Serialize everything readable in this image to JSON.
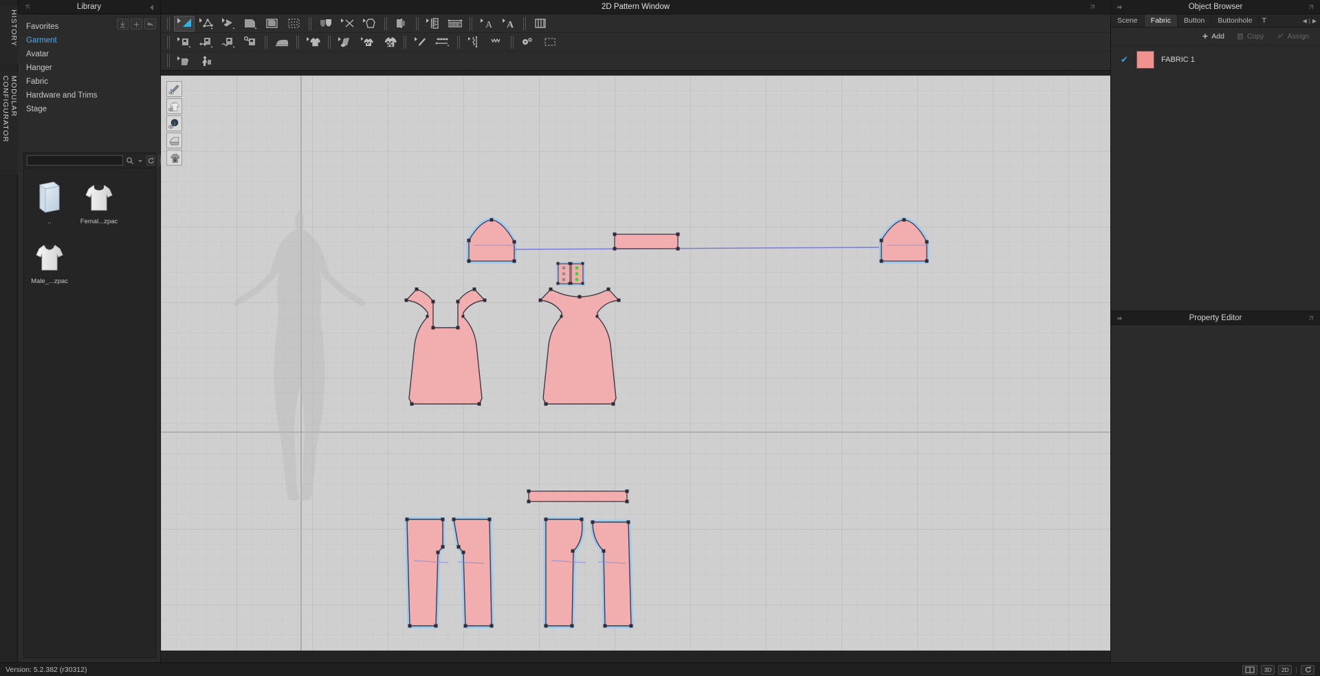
{
  "app": {
    "version_label": "Version: 5.2.382 (r30312)",
    "accent": "#5aa9e6",
    "fabric_color": "#f2aeae",
    "canvas_bg": "#cfcfcf"
  },
  "vertical_tabs": [
    {
      "label": "HISTORY",
      "name": "history"
    },
    {
      "label": "MODULAR CONFIGURATOR",
      "name": "modular-configurator"
    }
  ],
  "library": {
    "title": "Library",
    "tree": [
      {
        "label": "Favorites",
        "selected": false
      },
      {
        "label": "Garment",
        "selected": true
      },
      {
        "label": "Avatar",
        "selected": false
      },
      {
        "label": "Hanger",
        "selected": false
      },
      {
        "label": "Fabric",
        "selected": false
      },
      {
        "label": "Hardware and Trims",
        "selected": false
      },
      {
        "label": "Stage",
        "selected": false
      }
    ],
    "actions": [
      "download-icon",
      "add-icon",
      "undo-icon"
    ],
    "search": {
      "value": "",
      "placeholder": ""
    },
    "search_icons": [
      "search-icon",
      "chevron-down-icon",
      "refresh-icon",
      "list-view-icon"
    ],
    "items": [
      {
        "label": "..",
        "type": "folder"
      },
      {
        "label": "Femal...zpac",
        "type": "garment-female"
      },
      {
        "label": "Male_...zpac",
        "type": "garment-male"
      }
    ]
  },
  "main": {
    "title": "2D Pattern Window",
    "toolbar_rows": [
      [
        {
          "name": "edit-pattern-tool",
          "icon": "cursor-triangle",
          "active": true
        },
        {
          "name": "edit-curve-point-tool",
          "icon": "cursor-polyline",
          "active": false
        },
        {
          "name": "transform-pattern-tool",
          "icon": "cursor-pivot",
          "active": false
        },
        {
          "name": "polygon-tool",
          "icon": "polygon",
          "active": false
        },
        {
          "name": "rectangle-pattern-tool",
          "icon": "rect-shape",
          "active": false
        },
        {
          "name": "select-mesh-tool",
          "icon": "mesh-select",
          "active": false
        },
        {
          "sep": true
        },
        {
          "name": "internal-shape-tool",
          "icon": "shield-pair",
          "active": false
        },
        {
          "name": "cut-sew-tool",
          "icon": "scissors-cross",
          "active": false
        },
        {
          "name": "pattern-outline-tool",
          "icon": "outline-shape",
          "active": false
        },
        {
          "sep": true
        },
        {
          "name": "fold-pattern-tool",
          "icon": "fold-panel",
          "active": false
        },
        {
          "sep": true
        },
        {
          "name": "measure-tool",
          "icon": "ruler-vertical",
          "active": false
        },
        {
          "name": "tape-measure-tool",
          "icon": "tape-measure",
          "active": false
        },
        {
          "sep": true
        },
        {
          "name": "text-tool",
          "icon": "text-a",
          "active": false
        },
        {
          "name": "text-bold-tool",
          "icon": "text-a-bold",
          "active": false
        },
        {
          "sep": true
        },
        {
          "name": "grid-tool",
          "icon": "grid-columns",
          "active": false
        }
      ],
      [
        {
          "name": "sewing-tool",
          "icon": "cursor-seam",
          "active": false
        },
        {
          "name": "segment-sewing-tool",
          "icon": "seam-dots",
          "active": false
        },
        {
          "name": "free-sewing-tool",
          "icon": "seam-wave",
          "active": false
        },
        {
          "name": "edit-sewing-tool",
          "icon": "seam-search",
          "active": false
        },
        {
          "sep": true
        },
        {
          "name": "fusible-tool",
          "icon": "iron",
          "active": false
        },
        {
          "sep": true
        },
        {
          "name": "flatten-tool",
          "icon": "shirt-plain",
          "active": false
        },
        {
          "sep": true
        },
        {
          "name": "unroll-tool",
          "icon": "fabric-roll",
          "active": false
        },
        {
          "name": "texture-tool",
          "icon": "shirt-checker-small",
          "active": false
        },
        {
          "name": "print-layout-tool",
          "icon": "shirt-checker",
          "active": false
        },
        {
          "sep": true
        },
        {
          "name": "pleat-tool",
          "icon": "pen-diagonal",
          "active": false
        },
        {
          "name": "elastic-tool",
          "icon": "dots-line",
          "active": false
        },
        {
          "sep": true
        },
        {
          "name": "zigzag-tool",
          "icon": "zigzag",
          "active": false
        },
        {
          "name": "vvv-tool",
          "icon": "vvv",
          "active": false
        },
        {
          "sep": true
        },
        {
          "name": "button-tool",
          "icon": "buttons",
          "active": false
        },
        {
          "name": "marquee-tool",
          "icon": "marquee",
          "active": false
        }
      ],
      [
        {
          "name": "trace-tool",
          "icon": "trace",
          "active": false
        },
        {
          "name": "avatar-tool",
          "icon": "avatar-person",
          "active": false
        }
      ]
    ],
    "canvas_tools": [
      {
        "name": "show-pattern-outline",
        "icon": "pen-eye"
      },
      {
        "name": "show-garment",
        "icon": "shirt-eye"
      },
      {
        "name": "show-info",
        "icon": "info-eye"
      },
      {
        "name": "show-fabric",
        "icon": "fabric-fold"
      },
      {
        "name": "lock-pattern",
        "icon": "shirt-lock"
      }
    ]
  },
  "object_browser": {
    "title": "Object Browser",
    "tabs": [
      {
        "label": "Scene",
        "selected": false
      },
      {
        "label": "Fabric",
        "selected": true
      },
      {
        "label": "Button",
        "selected": false
      },
      {
        "label": "Buttonhole",
        "selected": false
      },
      {
        "label": "T",
        "selected": false,
        "truncated": true
      }
    ],
    "toolbar": [
      {
        "label": "Add",
        "icon": "plus-icon",
        "disabled": false
      },
      {
        "label": "Copy",
        "icon": "copy-icon",
        "disabled": true
      },
      {
        "label": "Assign",
        "icon": "assign-icon",
        "disabled": true
      }
    ],
    "items": [
      {
        "name": "FABRIC 1",
        "checked": true,
        "color": "#f2928f"
      }
    ]
  },
  "property_editor": {
    "title": "Property Editor"
  },
  "statusbar": {
    "version": "Version: 5.2.382 (r30312)",
    "buttons": [
      {
        "label": "",
        "name": "split-view-button",
        "icon": "split-icon"
      },
      {
        "label": "3D",
        "name": "view-3d-button"
      },
      {
        "label": "2D",
        "name": "view-2d-button"
      },
      {
        "label": "",
        "name": "reset-view-button",
        "icon": "refresh-icon"
      }
    ]
  },
  "pattern_pieces": [
    {
      "name": "sleeve-cap-left",
      "type": "sleeve",
      "selected": true
    },
    {
      "name": "collar-band",
      "type": "strip",
      "selected": false
    },
    {
      "name": "sleeve-cap-right",
      "type": "sleeve",
      "selected": true
    },
    {
      "name": "placket",
      "type": "button-placket",
      "selected": true
    },
    {
      "name": "front-bodice",
      "type": "bodice-front",
      "selected": false
    },
    {
      "name": "back-bodice",
      "type": "bodice-back",
      "selected": false
    },
    {
      "name": "waistband",
      "type": "strip",
      "selected": false
    },
    {
      "name": "pants-front",
      "type": "pants",
      "selected": true
    },
    {
      "name": "pants-back",
      "type": "pants",
      "selected": true
    }
  ]
}
